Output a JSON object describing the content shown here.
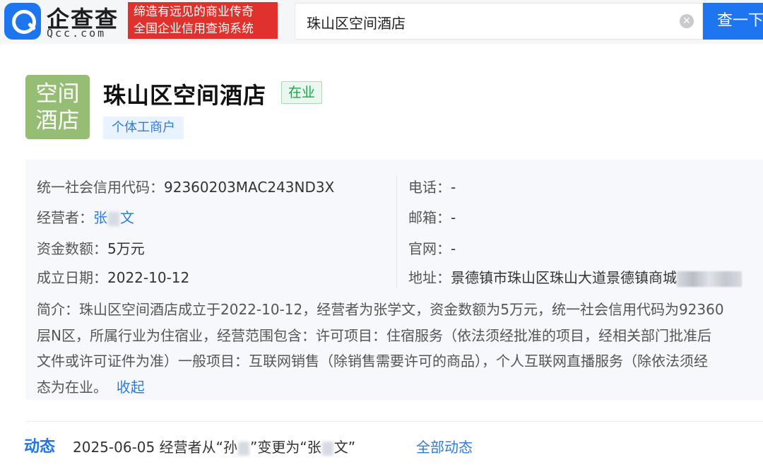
{
  "header": {
    "logo_text": "企查查",
    "logo_domain": "Qcc.com",
    "slogan_line1": "缔造有远见的商业传奇",
    "slogan_line2": "全国企业信用查询系统",
    "search_value": "珠山区空间酒店",
    "search_button": "查一下"
  },
  "company": {
    "avatar_line1": "空间",
    "avatar_line2": "酒店",
    "name": "珠山区空间酒店",
    "status": "在业",
    "type_tag": "个体工商户"
  },
  "info": {
    "credit_code_label": "统一社会信用代码：",
    "credit_code": "92360203MAC243ND3X",
    "operator_label": "经营者：",
    "operator_a": "张",
    "operator_b": "文",
    "capital_label": "资金数额：",
    "capital": "5万元",
    "date_label": "成立日期：",
    "date": "2022-10-12",
    "phone_label": "电话：",
    "phone": "-",
    "email_label": "邮箱：",
    "email": "-",
    "website_label": "官网：",
    "website": "-",
    "address_label": "地址：",
    "address": "景德镇市珠山区珠山大道景德镇商城"
  },
  "intro": {
    "line1": "简介：珠山区空间酒店成立于2022-10-12，经营者为张学文，资金数额为5万元，统一社会信用代码为92360",
    "line2": "层N区，所属行业为住宿业，经营范围包含：许可项目：住宿服务（依法须经批准的项目，经相关部门批准后",
    "line3": "文件或许可证件为准）一般项目：互联网销售（除销售需要许可的商品），个人互联网直播服务（除依法须经",
    "line4": "态为在业。",
    "collapse": "收起"
  },
  "dynamics": {
    "title": "动态",
    "date": "2025-06-05",
    "text_a": "经营者从“孙",
    "text_b": "”变更为“张",
    "text_c": "文”",
    "all_link": "全部动态"
  }
}
